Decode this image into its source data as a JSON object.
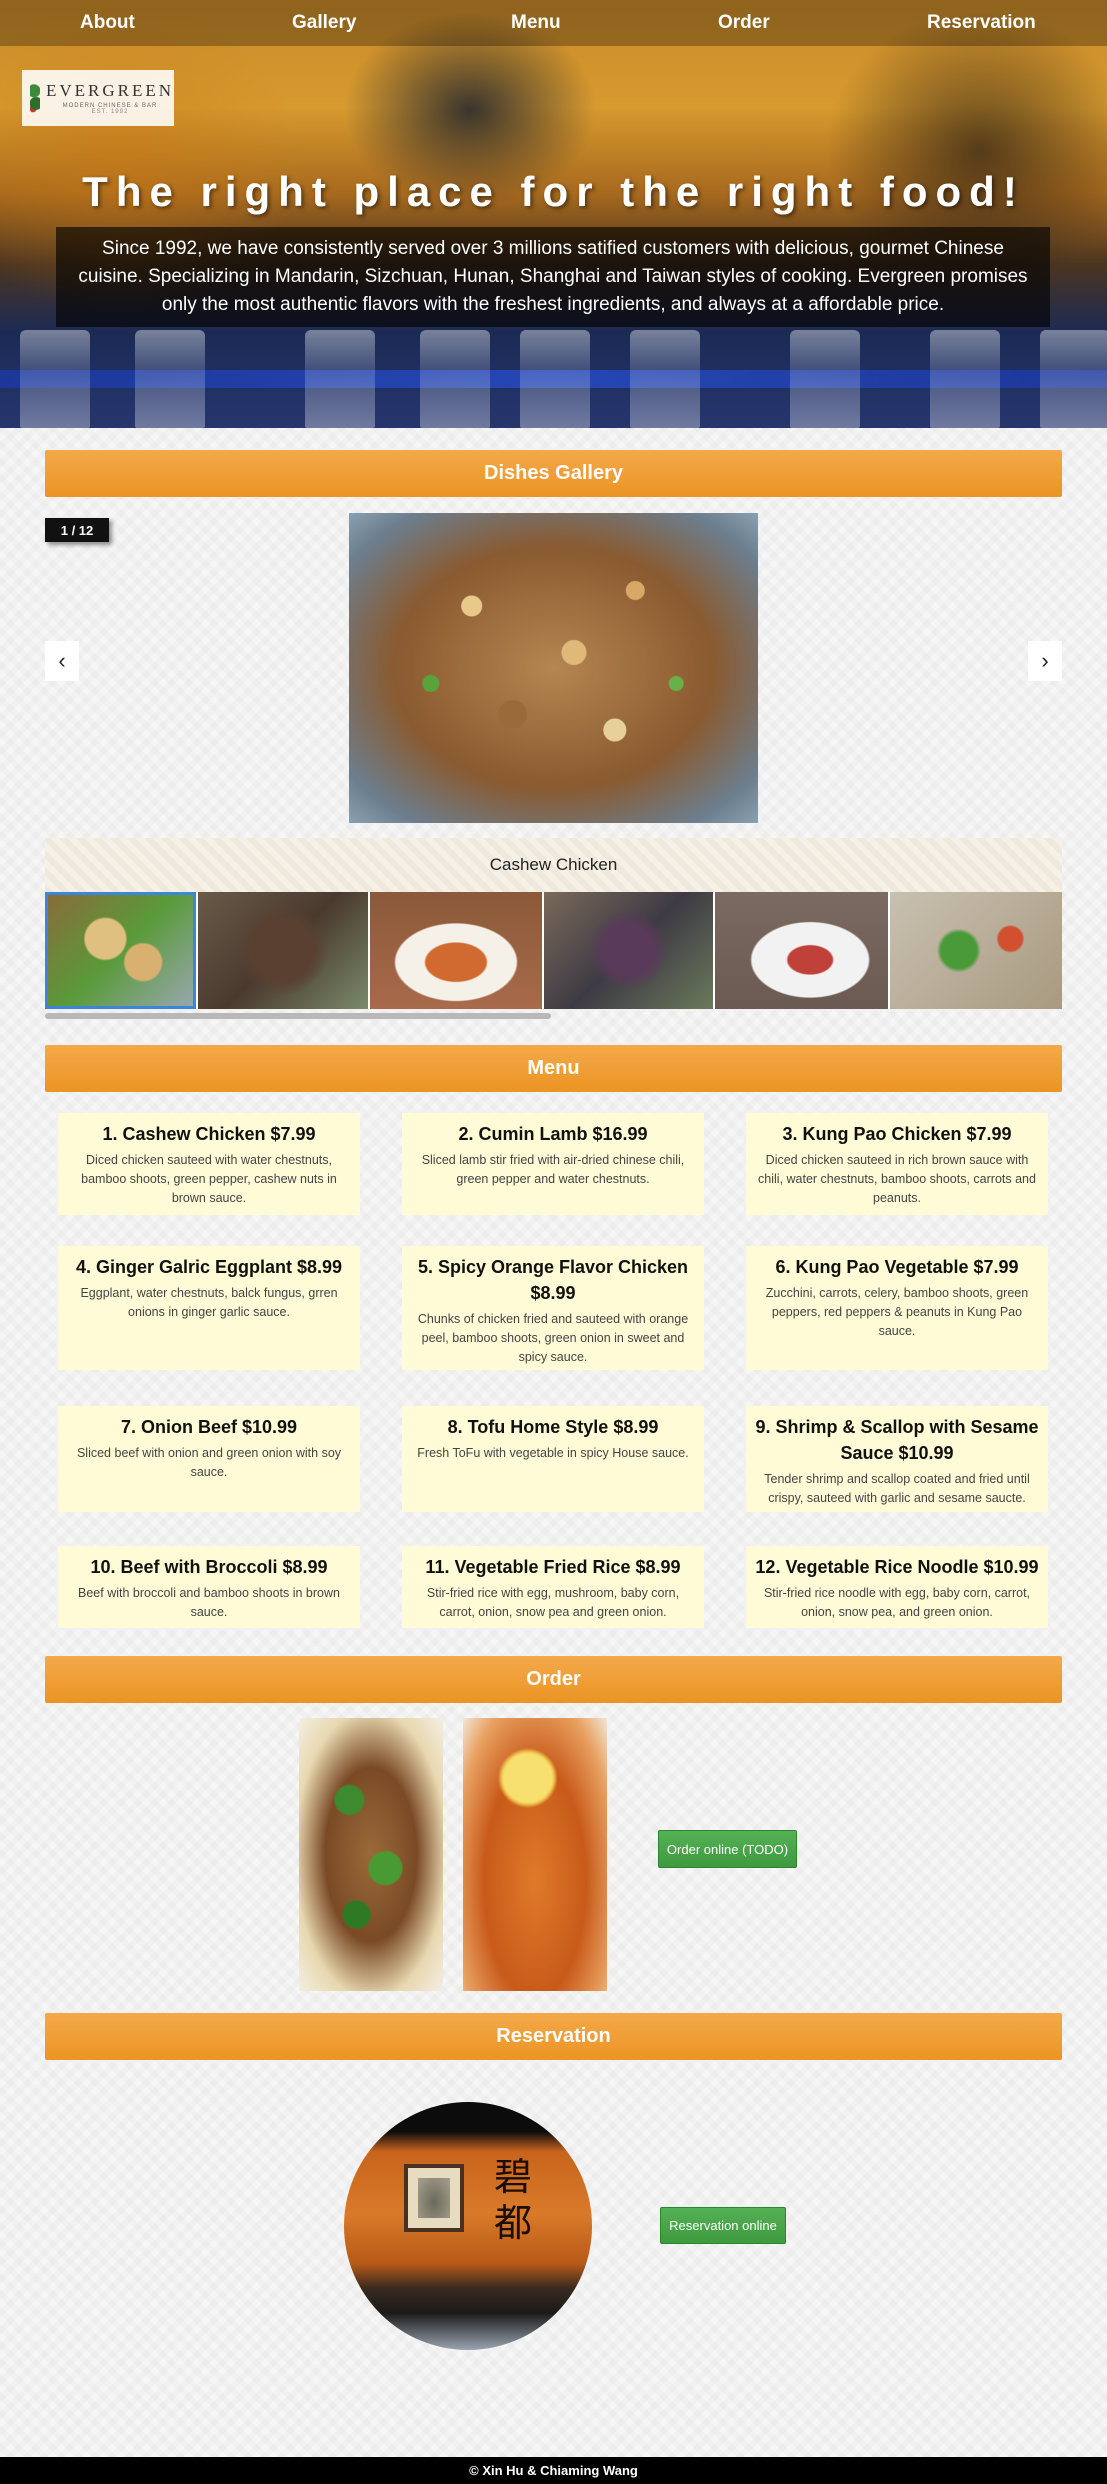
{
  "nav": {
    "about": "About",
    "gallery": "Gallery",
    "menu": "Menu",
    "order": "Order",
    "reservation": "Reservation"
  },
  "logo": {
    "name": "EVERGREEN",
    "subtitle": "MODERN CHINESE & BAR",
    "est": "EST. 1992"
  },
  "hero": {
    "title": "The right place for the right food!",
    "description": "Since 1992, we have consistently served over 3 millions satified customers with delicious, gourmet Chinese cuisine. Specializing in Mandarin, Sizchuan, Hunan, Shanghai and Taiwan styles of cooking. Evergreen promises only the most authentic flavors with the freshest ingredients, and always at a affordable price."
  },
  "gallery": {
    "header": "Dishes Gallery",
    "counter": "1 / 12",
    "prev_label": "‹",
    "next_label": "›",
    "caption": "Cashew Chicken",
    "thumbnails": [
      "cashew-chicken",
      "cumin-lamb",
      "kung-pao-chicken",
      "ginger-garlic-eggplant",
      "spicy-orange-chicken",
      "kung-pao-vegetable"
    ]
  },
  "menu": {
    "header": "Menu",
    "items": [
      {
        "title": "1. Cashew Chicken $7.99",
        "desc": "Diced chicken sauteed with water chestnuts, bamboo shoots, green pepper, cashew nuts in brown sauce."
      },
      {
        "title": "2. Cumin Lamb $16.99",
        "desc": "Sliced lamb stir fried with air-dried chinese chili, green pepper and water chestnuts."
      },
      {
        "title": "3. Kung Pao Chicken $7.99",
        "desc": "Diced chicken sauteed in rich brown sauce with chili, water chestnuts, bamboo shoots, carrots and peanuts."
      },
      {
        "title": "4. Ginger Galric Eggplant $8.99",
        "desc": "Eggplant, water chestnuts, balck fungus, grren onions in ginger garlic sauce."
      },
      {
        "title": "5. Spicy Orange Flavor Chicken $8.99",
        "desc": "Chunks of chicken fried and sauteed with orange peel, bamboo shoots, green onion in sweet and spicy sauce."
      },
      {
        "title": "6. Kung Pao Vegetable $7.99",
        "desc": "Zucchini, carrots, celery, bamboo shoots, green peppers, red peppers & peanuts in Kung Pao sauce."
      },
      {
        "title": "7. Onion Beef $10.99",
        "desc": "Sliced beef with onion and green onion with soy sauce."
      },
      {
        "title": "8. Tofu Home Style $8.99",
        "desc": "Fresh ToFu with vegetable in spicy House sauce."
      },
      {
        "title": "9. Shrimp & Scallop with Sesame Sauce $10.99",
        "desc": "Tender shrimp and scallop coated and fried until crispy, sauteed with garlic and sesame saucte."
      },
      {
        "title": "10. Beef with Broccoli $8.99",
        "desc": "Beef with broccoli and bamboo shoots in brown sauce."
      },
      {
        "title": "11. Vegetable Fried Rice $8.99",
        "desc": "Stir-fried rice with egg, mushroom, baby corn, carrot, onion, snow pea and green onion."
      },
      {
        "title": "12. Vegetable Rice Noodle $10.99",
        "desc": "Stir-fried rice noodle with egg, baby corn, carrot, onion, snow pea, and green onion."
      }
    ]
  },
  "order": {
    "header": "Order",
    "button": "Order online (TODO)"
  },
  "reservation": {
    "header": "Reservation",
    "button": "Reservation online",
    "sign_chars": "碧都"
  },
  "footer": {
    "credit": "© Xin Hu & Chiaming Wang"
  },
  "colors": {
    "section_header": "#ec9424",
    "menu_card": "#fffbd6",
    "button_green": "#47a447",
    "footer": "#000000"
  }
}
